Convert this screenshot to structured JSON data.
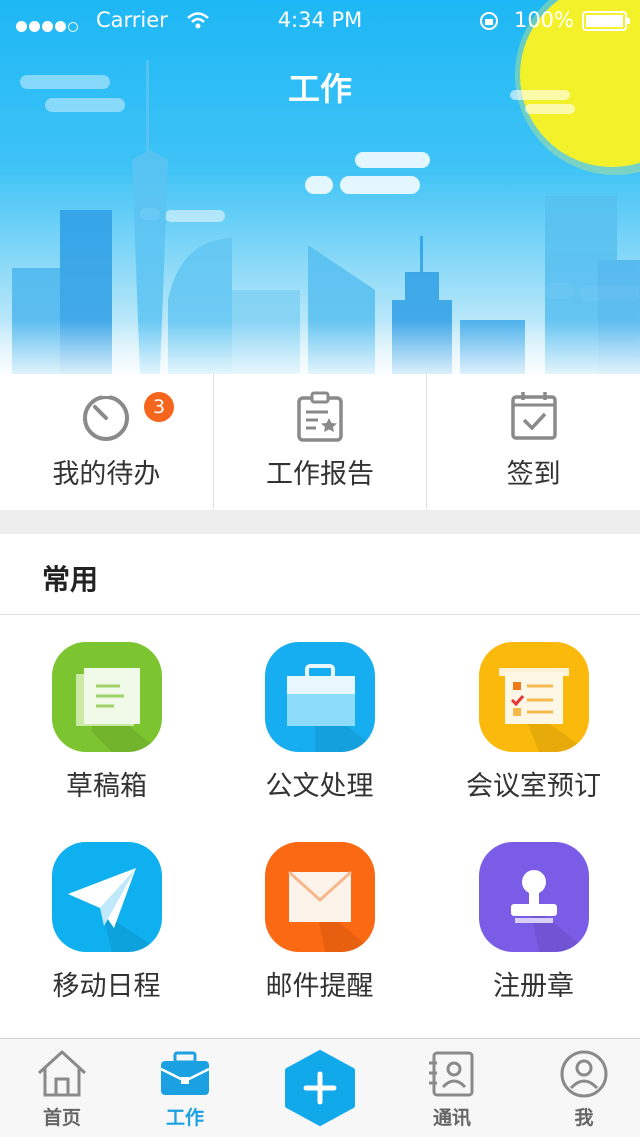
{
  "status_bar": {
    "carrier": "Carrier",
    "time": "4:34 PM",
    "battery": "100%"
  },
  "header": {
    "title": "工作"
  },
  "quick_actions": [
    {
      "label": "我的待办",
      "icon": "timer-icon",
      "badge": "3"
    },
    {
      "label": "工作报告",
      "icon": "clipboard-report-icon"
    },
    {
      "label": "签到",
      "icon": "calendar-check-icon"
    }
  ],
  "common": {
    "heading": "常用",
    "apps": [
      {
        "label": "草稿箱",
        "icon": "drafts-icon",
        "color": "#7cc531"
      },
      {
        "label": "公文处理",
        "icon": "briefcase-icon",
        "color": "#16aef0"
      },
      {
        "label": "会议室预订",
        "icon": "meeting-board-icon",
        "color": "#fbb90c"
      },
      {
        "label": "移动日程",
        "icon": "paper-plane-icon",
        "color": "#0fb0ef"
      },
      {
        "label": "邮件提醒",
        "icon": "envelope-icon",
        "color": "#fb6912"
      },
      {
        "label": "注册章",
        "icon": "stamp-icon",
        "color": "#7a5ce6"
      }
    ]
  },
  "tabbar": {
    "items": [
      {
        "label": "首页",
        "icon": "home-icon"
      },
      {
        "label": "工作",
        "icon": "work-briefcase-icon",
        "active": true
      },
      {
        "label": "通讯",
        "icon": "contacts-icon"
      },
      {
        "label": "我",
        "icon": "profile-icon"
      }
    ],
    "center_icon": "plus-icon"
  },
  "colors": {
    "accent": "#1ba1e2",
    "badge": "#f6651c"
  }
}
